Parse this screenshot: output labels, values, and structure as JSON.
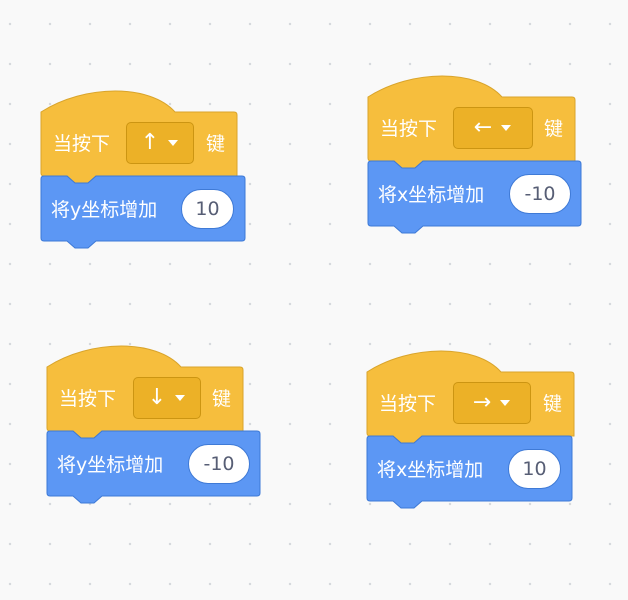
{
  "colors": {
    "events_fill": "#f6be3d",
    "events_border": "#d9a42b",
    "events_dropdown": "#ecb127",
    "motion_fill": "#5c97f4",
    "motion_border": "#3d79d6",
    "workspace_bg": "#f9f9f9"
  },
  "icons": {
    "dropdown": "caret-down-icon"
  },
  "scripts": [
    {
      "hat": {
        "prefix": "当按下",
        "key": "↑",
        "suffix": "键"
      },
      "action": {
        "label": "将y坐标增加",
        "value": "10"
      }
    },
    {
      "hat": {
        "prefix": "当按下",
        "key": "←",
        "suffix": "键"
      },
      "action": {
        "label": "将x坐标增加",
        "value": "-10"
      }
    },
    {
      "hat": {
        "prefix": "当按下",
        "key": "↓",
        "suffix": "键"
      },
      "action": {
        "label": "将y坐标增加",
        "value": "-10"
      }
    },
    {
      "hat": {
        "prefix": "当按下",
        "key": "→",
        "suffix": "键"
      },
      "action": {
        "label": "将x坐标增加",
        "value": "10"
      }
    }
  ]
}
